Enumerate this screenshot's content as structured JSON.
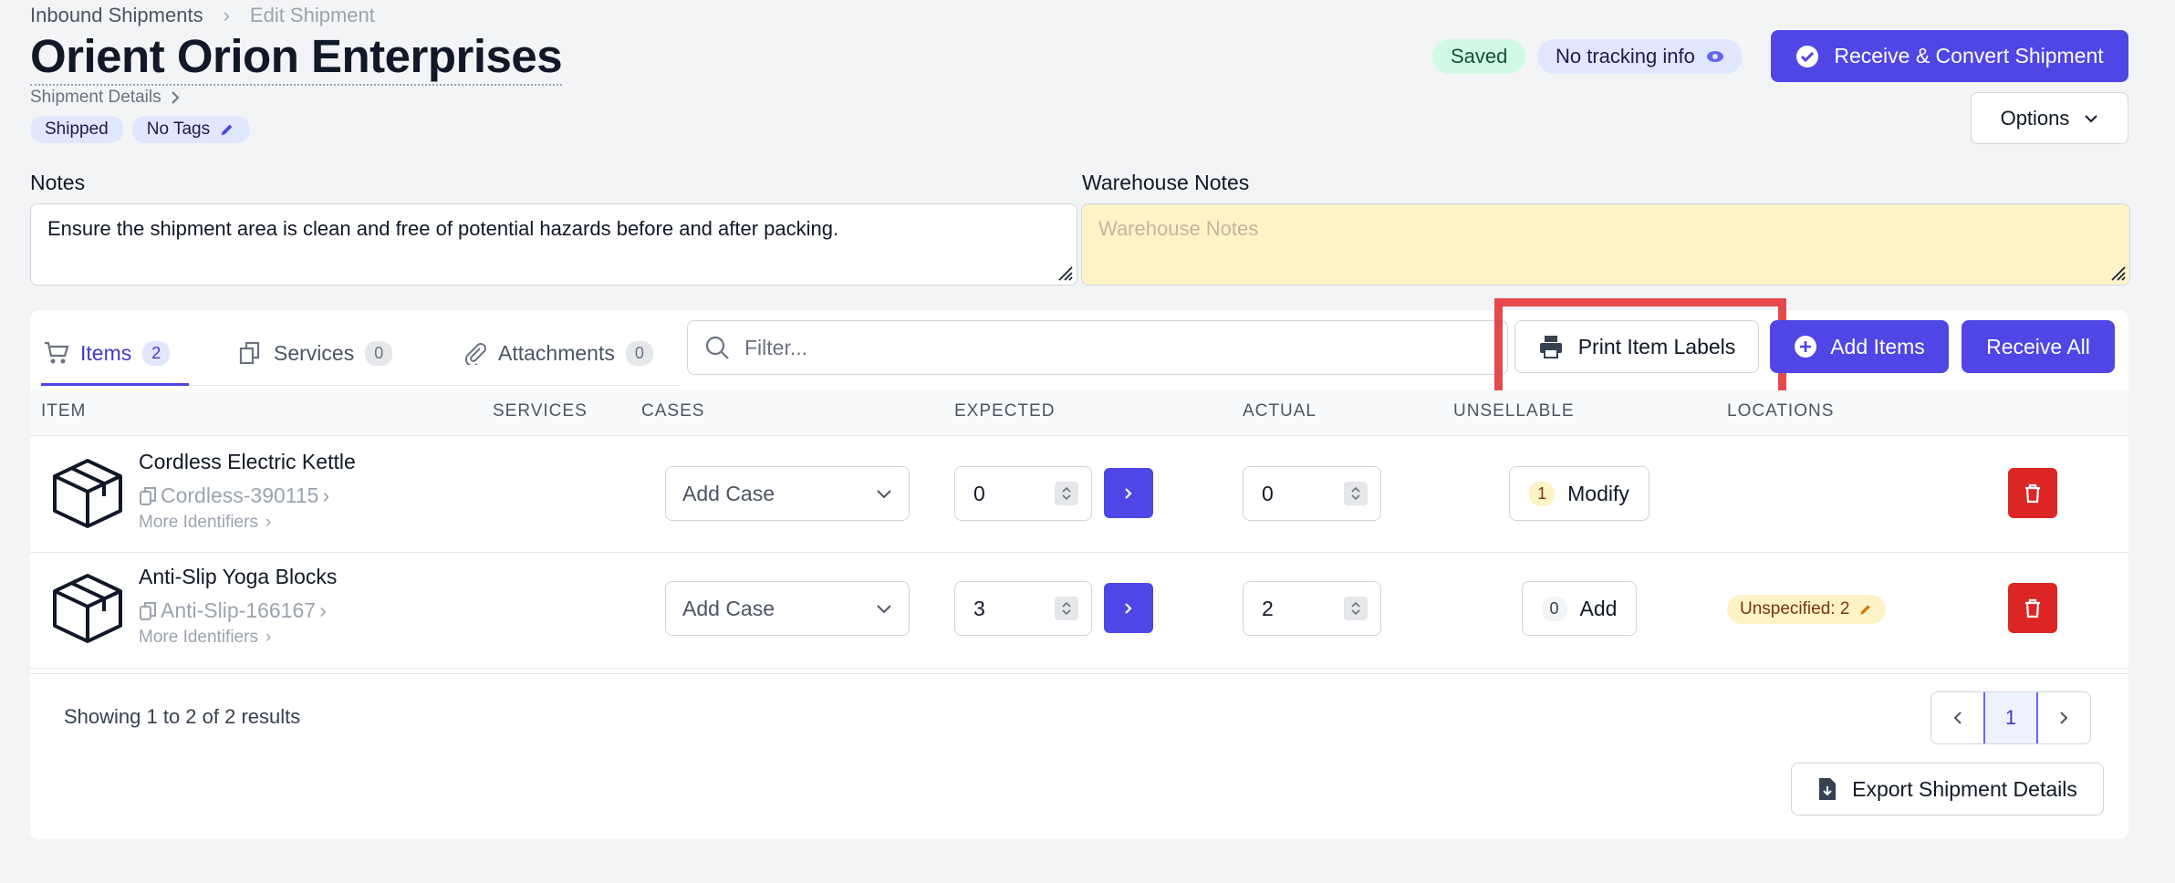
{
  "breadcrumb": {
    "parent": "Inbound Shipments",
    "current": "Edit Shipment"
  },
  "header": {
    "title": "Orient Orion Enterprises",
    "details_link": "Shipment Details",
    "status_tag": "Shipped",
    "tags_label": "No Tags",
    "saved_badge": "Saved",
    "tracking_badge": "No tracking info",
    "receive_convert_label": "Receive & Convert Shipment",
    "options_label": "Options"
  },
  "notes": {
    "label": "Notes",
    "value": "Ensure the shipment area is clean and free of potential hazards before and after packing.",
    "warehouse_label": "Warehouse Notes",
    "warehouse_placeholder": "Warehouse Notes"
  },
  "tabs": [
    {
      "label": "Items",
      "count": "2"
    },
    {
      "label": "Services",
      "count": "0"
    },
    {
      "label": "Attachments",
      "count": "0"
    }
  ],
  "toolbar": {
    "filter_placeholder": "Filter...",
    "print_labels": "Print Item Labels",
    "add_items": "Add Items",
    "receive_all": "Receive All"
  },
  "columns": [
    "ITEM",
    "SERVICES",
    "CASES",
    "EXPECTED",
    "ACTUAL",
    "UNSELLABLE",
    "LOCATIONS"
  ],
  "rows": [
    {
      "name": "Cordless Electric Kettle",
      "sku": "Cordless-390115",
      "more": "More Identifiers",
      "case": "Add Case",
      "expected": "0",
      "actual": "0",
      "unsellable_count": "1",
      "unsellable_action": "Modify",
      "location": ""
    },
    {
      "name": "Anti-Slip Yoga Blocks",
      "sku": "Anti-Slip-166167",
      "more": "More Identifiers",
      "case": "Add Case",
      "expected": "3",
      "actual": "2",
      "unsellable_count": "0",
      "unsellable_action": "Add",
      "location": "Unspecified: 2"
    }
  ],
  "footer": {
    "showing": "Showing 1 to 2 of 2 results",
    "current_page": "1",
    "export_label": "Export Shipment Details"
  },
  "colors": {
    "accent": "#4f46e5",
    "danger": "#dc2626",
    "highlight": "#e5484d",
    "saved": "#d1fae5",
    "warehouse_bg": "#fef3c7"
  }
}
